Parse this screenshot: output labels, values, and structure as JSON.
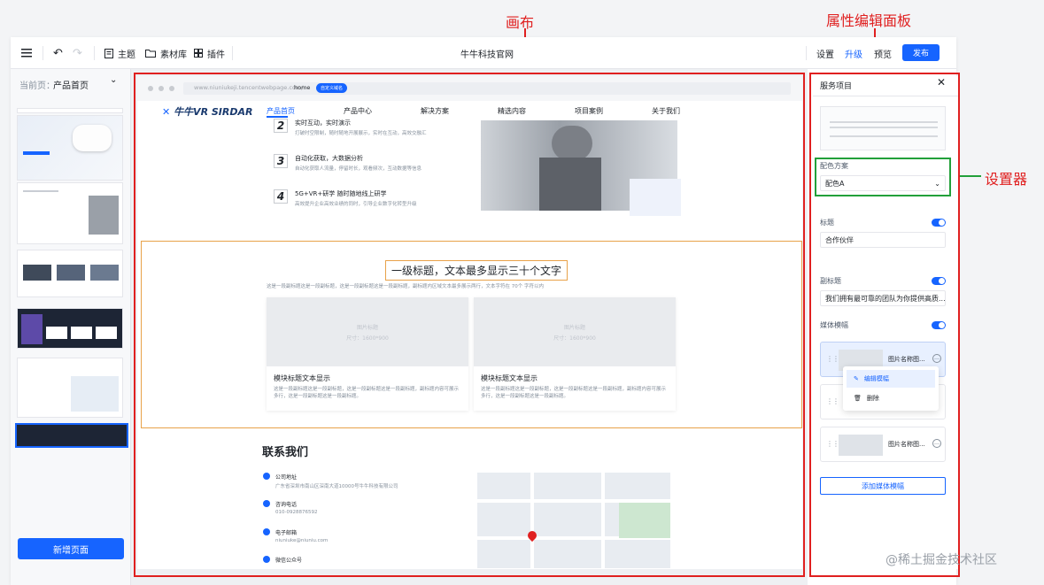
{
  "annotations": {
    "canvas": "画布",
    "panel": "属性编辑面板",
    "setter": "设置器"
  },
  "toolbar": {
    "undo": "undo-icon",
    "redo": "redo-icon",
    "theme": "主题",
    "materials": "素材库",
    "plugins": "插件",
    "site_title": "牛牛科技官网",
    "settings": "设置",
    "upgrade": "升级",
    "preview": "预览",
    "publish": "发布"
  },
  "left": {
    "current_label": "当前页：",
    "current_page": "产品首页",
    "add_page": "新增页面"
  },
  "browser": {
    "url": "www.niuniukeji.tencentwebpage.com/",
    "tab": "home",
    "badge": "自定义域名"
  },
  "site": {
    "logo": "牛牛VR SIRDAR",
    "nav": [
      "产品首页",
      "产品中心",
      "解决方案",
      "精选内容",
      "项目案例",
      "关于我们"
    ],
    "steps": [
      {
        "num": "2",
        "title": "实时互动，实时演示",
        "desc": "打破时空限制，随时随地开展展示，实时在互动，高效交融汇"
      },
      {
        "num": "3",
        "title": "自动化获取，大数据分析",
        "desc": "自动化获取人流量，停留时长，观看频次，互动数据等信息"
      },
      {
        "num": "4",
        "title": "5G+VR+研学  随时随地线上研学",
        "desc": "高效提升企业高效业绩的同时，引导企业数字化转型升级"
      }
    ],
    "section_title": "一级标题，文本最多显示三十个文字",
    "section_sub": "这是一段副标题这是一段副标题，这是一段副标题这是一段副标题，副标题内区域文本最多展示两行，文本字符在 70个 字符以内",
    "cards": [
      {
        "img_label": "图片标题",
        "img_size": "尺寸：1600*900",
        "title": "模块标题文本显示",
        "desc": "这是一段副标题这是一段副标题，这是一段副标题这是一段副标题，副标题内容可展示多行，这是一段副标题这是一段副标题。"
      },
      {
        "img_label": "图片标题",
        "img_size": "尺寸：1600*900",
        "title": "模块标题文本显示",
        "desc": "这是一段副标题这是一段副标题，这是一段副标题这是一段副标题，副标题内容可展示多行，这是一段副标题这是一段副标题。"
      }
    ],
    "contact_title": "联系我们",
    "contacts": [
      {
        "label": "公司地址",
        "value": "广东省深圳市南山区深南大道10000号牛牛科技有限公司"
      },
      {
        "label": "咨询电话",
        "value": "010-0928876592"
      },
      {
        "label": "电子邮箱",
        "value": "niuniuke@niuniu.com"
      },
      {
        "label": "微信公众号",
        "value": ""
      }
    ]
  },
  "panel": {
    "title": "服务项目",
    "color_scheme_label": "配色方案",
    "color_scheme_value": "配色A",
    "heading_label": "标题",
    "heading_value": "合作伙伴",
    "subheading_label": "副标题",
    "subheading_value": "我们拥有最可靠的团队为你提供高质...",
    "media_label": "媒体模幅",
    "media_items": [
      "图片名称图...",
      "图片名称图..."
    ],
    "menu_edit": "编辑模幅",
    "menu_delete": "删除",
    "add_media": "添加媒体模幅"
  },
  "watermark": "@稀土掘金技术社区"
}
